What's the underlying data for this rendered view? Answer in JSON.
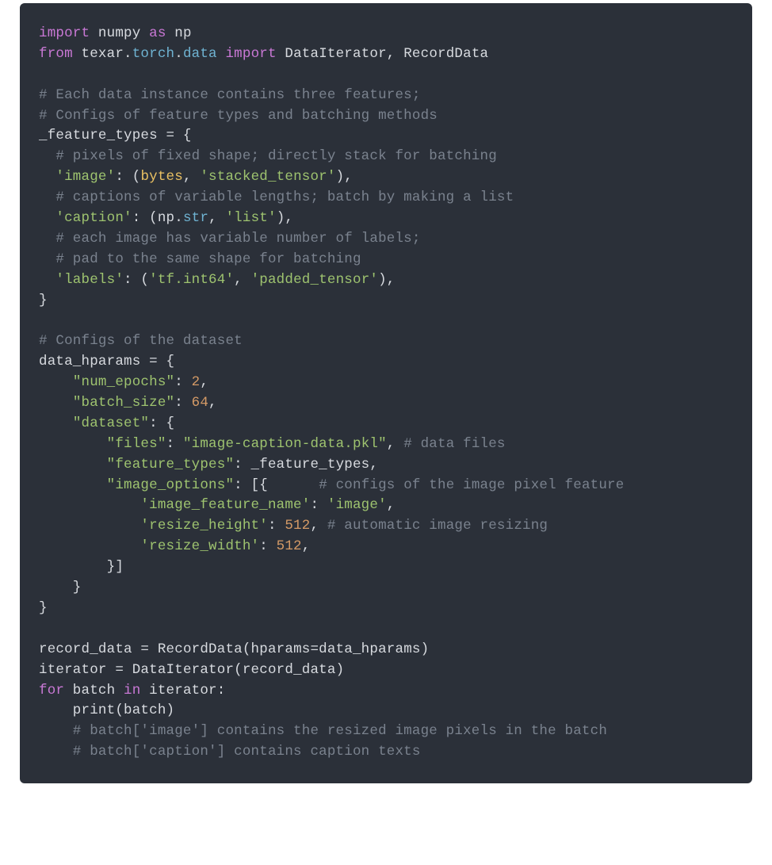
{
  "code": {
    "l1": {
      "import": "import",
      "numpy": "numpy",
      "as": "as",
      "np": "np"
    },
    "l2": {
      "from": "from",
      "texar": "texar",
      "torch": "torch",
      "data": "data",
      "import": "import",
      "names": "DataIterator, RecordData"
    },
    "l4": "# Each data instance contains three features;",
    "l5": "# Configs of feature types and batching methods",
    "l6": {
      "var": "_feature_types",
      "eq": " = {"
    },
    "l7": "  # pixels of fixed shape; directly stack for batching",
    "l8": {
      "key": "'image'",
      "colon": ": (",
      "bytes": "bytes",
      "comma": ", ",
      "val": "'stacked_tensor'",
      "close": "),"
    },
    "l9": "  # captions of variable lengths; batch by making a list",
    "l10": {
      "key": "'caption'",
      "colon": ": (np.",
      "str": "str",
      "comma": ", ",
      "val": "'list'",
      "close": "),"
    },
    "l11": "  # each image has variable number of labels;",
    "l12": "  # pad to the same shape for batching",
    "l13": {
      "key": "'labels'",
      "colon": ": (",
      "intval": "'tf.int64'",
      "comma": ", ",
      "val": "'padded_tensor'",
      "close": "),"
    },
    "l14": "}",
    "l16": "# Configs of the dataset",
    "l17": {
      "var": "data_hparams",
      "eq": " = {"
    },
    "l18": {
      "key": "\"num_epochs\"",
      "colon": ": ",
      "val": "2",
      "comma": ","
    },
    "l19": {
      "key": "\"batch_size\"",
      "colon": ": ",
      "val": "64",
      "comma": ","
    },
    "l20": {
      "key": "\"dataset\"",
      "colon": ": {"
    },
    "l21": {
      "key": "\"files\"",
      "colon": ": ",
      "val": "\"image-caption-data.pkl\"",
      "comma": ", ",
      "comment": "# data files"
    },
    "l22": {
      "key": "\"feature_types\"",
      "colon": ": _feature_types,"
    },
    "l23": {
      "key": "\"image_options\"",
      "colon": ": [{      ",
      "comment": "# configs of the image pixel feature"
    },
    "l24": {
      "key": "'image_feature_name'",
      "colon": ": ",
      "val": "'image'",
      "comma": ","
    },
    "l25": {
      "key": "'resize_height'",
      "colon": ": ",
      "val": "512",
      "comma": ", ",
      "comment": "# automatic image resizing"
    },
    "l26": {
      "key": "'resize_width'",
      "colon": ": ",
      "val": "512",
      "comma": ","
    },
    "l27": "        }]",
    "l28": "    }",
    "l29": "}",
    "l31": {
      "var": "record_data",
      "eq": " = RecordData(hparams=data_hparams)"
    },
    "l32": {
      "var": "iterator",
      "eq": " = DataIterator(record_data)"
    },
    "l33": {
      "for": "for",
      "batch": " batch ",
      "in": "in",
      "iterator": " iterator:"
    },
    "l34": {
      "print": "    print",
      "args": "(batch)"
    },
    "l35": "    # batch['image'] contains the resized image pixels in the batch",
    "l36": "    # batch['caption'] contains caption texts"
  }
}
